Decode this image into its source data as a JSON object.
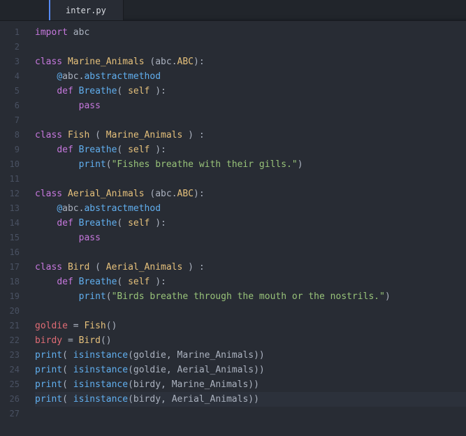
{
  "tab": {
    "filename": "inter.py"
  },
  "gutter": {
    "start": 1,
    "end": 27
  },
  "code": {
    "l1": {
      "kw_import": "import",
      "sp": " ",
      "mod": "abc"
    },
    "l3": {
      "kw_class": "class",
      "name": "Marine_Animals",
      "lp": " (",
      "base_mod": "abc",
      "dot": ".",
      "base_cls": "ABC",
      "rp": "):"
    },
    "l4": {
      "indent": "    ",
      "at": "@",
      "mod": "abc",
      "dot": ".",
      "dec": "abstractmethod"
    },
    "l5": {
      "indent": "    ",
      "kw_def": "def",
      "sp": " ",
      "fn": "Breathe",
      "lp": "( ",
      "self": "self",
      "rp": " ):"
    },
    "l6": {
      "indent": "        ",
      "kw_pass": "pass"
    },
    "l8": {
      "kw_class": "class",
      "name": "Fish",
      "lp": " ( ",
      "base": "Marine_Animals",
      "rp": " ) :"
    },
    "l9": {
      "indent": "    ",
      "kw_def": "def",
      "sp": " ",
      "fn": "Breathe",
      "lp": "( ",
      "self": "self",
      "rp": " ):"
    },
    "l10": {
      "indent": "        ",
      "fn": "print",
      "lp": "(",
      "str": "\"Fishes breathe with their gills.\"",
      "rp": ")"
    },
    "l12": {
      "kw_class": "class",
      "name": "Aerial_Animals",
      "lp": " (",
      "base_mod": "abc",
      "dot": ".",
      "base_cls": "ABC",
      "rp": "):"
    },
    "l13": {
      "indent": "    ",
      "at": "@",
      "mod": "abc",
      "dot": ".",
      "dec": "abstractmethod"
    },
    "l14": {
      "indent": "    ",
      "kw_def": "def",
      "sp": " ",
      "fn": "Breathe",
      "lp": "( ",
      "self": "self",
      "rp": " ):"
    },
    "l15": {
      "indent": "        ",
      "kw_pass": "pass"
    },
    "l17": {
      "kw_class": "class",
      "name": "Bird",
      "lp": " ( ",
      "base": "Aerial_Animals",
      "rp": " ) :"
    },
    "l18": {
      "indent": "    ",
      "kw_def": "def",
      "sp": " ",
      "fn": "Breathe",
      "lp": "( ",
      "self": "self",
      "rp": " ):"
    },
    "l19": {
      "indent": "        ",
      "fn": "print",
      "lp": "(",
      "str": "\"Birds breathe through the mouth or the nostrils.\"",
      "rp": ")"
    },
    "l21": {
      "var": "goldie",
      "eq": " = ",
      "cls": "Fish",
      "call": "()"
    },
    "l22": {
      "var": "birdy",
      "eq": " = ",
      "cls": "Bird",
      "call": "()"
    },
    "l23": {
      "fn": "print",
      "lp": "( ",
      "fn2": "isinstance",
      "lp2": "(",
      "arg1": "goldie",
      "comma": ", ",
      "arg2": "Marine_Animals",
      "rp": "))"
    },
    "l24": {
      "fn": "print",
      "lp": "( ",
      "fn2": "isinstance",
      "lp2": "(",
      "arg1": "goldie",
      "comma": ", ",
      "arg2": "Aerial_Animals",
      "rp": "))"
    },
    "l25": {
      "fn": "print",
      "lp": "( ",
      "fn2": "isinstance",
      "lp2": "(",
      "arg1": "birdy",
      "comma": ", ",
      "arg2": "Marine_Animals",
      "rp": "))"
    },
    "l26": {
      "fn": "print",
      "lp": "( ",
      "fn2": "isinstance",
      "lp2": "(",
      "arg1": "birdy",
      "comma": ", ",
      "arg2": "Aerial_Animals",
      "rp": "))"
    }
  }
}
